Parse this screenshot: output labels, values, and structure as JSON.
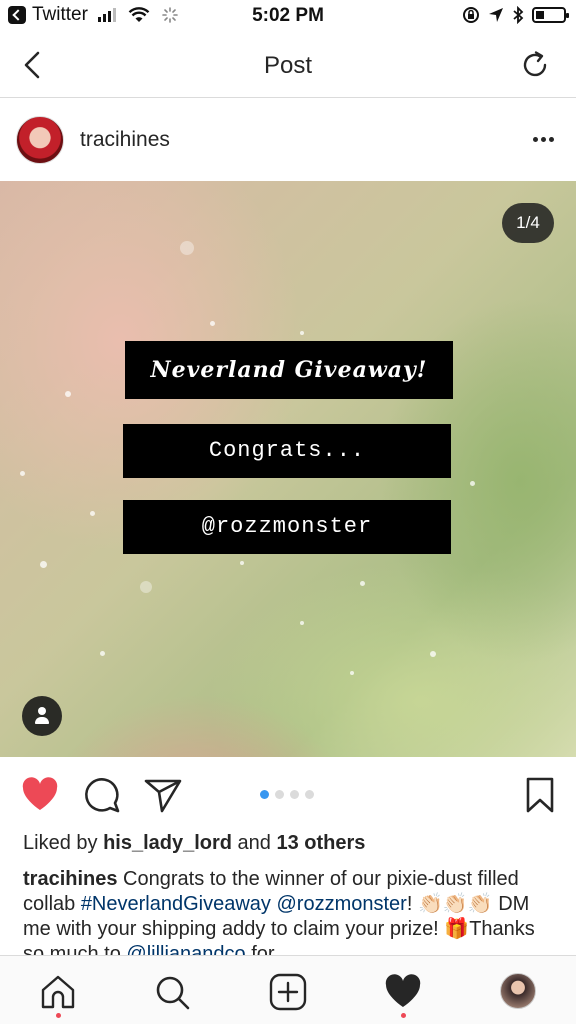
{
  "status_bar": {
    "back_app": "Twitter",
    "time": "5:02 PM",
    "battery_level": 0.25
  },
  "nav": {
    "title": "Post"
  },
  "post": {
    "username": "tracihines",
    "page_counter": "1/4",
    "carousel": {
      "count": 4,
      "active_index": 0
    },
    "banners": [
      "Neverland Giveaway!",
      "Congrats...",
      "@rozzmonster"
    ],
    "liked_by_prefix": "Liked by ",
    "liked_by_user": "his_lady_lord",
    "liked_by_suffix": " and ",
    "liked_by_others": "13 others",
    "caption": {
      "author": "tracihines",
      "text_1": " Congrats to the winner of our pixie-dust filled collab ",
      "hashtag": "#NeverlandGiveaway",
      "space": " ",
      "mention": "@rozzmonster",
      "text_2": "! 👏🏻👏🏻👏🏻 DM me with your shipping addy to claim your prize! 🎁Thanks so much to ",
      "mention_2": "@lillianandco",
      "text_3": " for"
    }
  },
  "colors": {
    "like_red": "#ed4956",
    "link_blue": "#003569",
    "dot_active": "#3897f0"
  },
  "icons": {
    "like": "heart-icon",
    "comment": "comment-icon",
    "share": "send-icon",
    "save": "bookmark-icon",
    "home": "home-icon",
    "search": "search-icon",
    "add": "add-icon",
    "activity": "heart-icon"
  }
}
